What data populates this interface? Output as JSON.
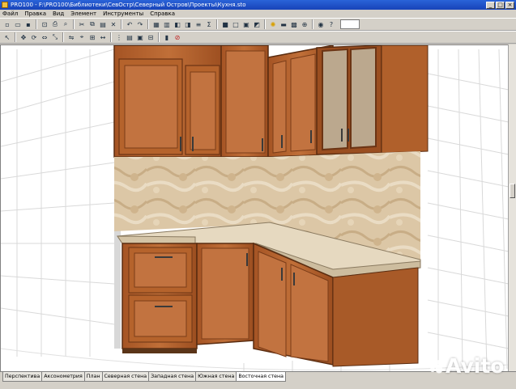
{
  "window": {
    "title": "PRO100 - F:\\PRO100\\Библиотеки\\СевОстр\\Северный Остров\\Проекты\\Кухня.sto"
  },
  "menu": [
    "Файл",
    "Правка",
    "Вид",
    "Элемент",
    "Инструменты",
    "Справка"
  ],
  "toolbar1_icons": [
    "new-icon",
    "open-icon",
    "save-icon",
    "print-preview-icon",
    "print-icon",
    "find-icon",
    "cut-icon",
    "copy-icon",
    "paste-icon",
    "delete-icon",
    "undo-icon",
    "redo-icon",
    "properties-icon",
    "library-icon",
    "materials-icon",
    "elements-icon",
    "align-icon",
    "sum-icon",
    "view-solid-icon",
    "view-wire-icon",
    "view-textured-icon",
    "shading-icon",
    "lightbulb-icon",
    "ruler-icon",
    "grid-icon",
    "zoom-icon",
    "eye-icon",
    "help-icon"
  ],
  "toolbar2_icons": [
    "select-arrow-icon",
    "pan-icon",
    "rotate-icon",
    "move-icon",
    "scale-icon",
    "mirror-icon",
    "snap-icon",
    "bind-icon",
    "dimension-icon",
    "distribute-icon",
    "stack-icon",
    "group-icon",
    "ungroup-icon",
    "lock-icon",
    "stop-icon"
  ],
  "tabs": [
    "Перспектива",
    "Аксонометрия",
    "План",
    "Северная стена",
    "Западная стена",
    "Южная стена",
    "Восточная стена"
  ],
  "active_tab": "Восточная стена",
  "watermark": "Avito",
  "colors": {
    "title_bar": "#1a4fc4",
    "cabinet_wood": "#b0612c",
    "countertop": "#e4d6bc",
    "backsplash": "#ddc7a4",
    "grid_line": "#d8d8d8"
  }
}
